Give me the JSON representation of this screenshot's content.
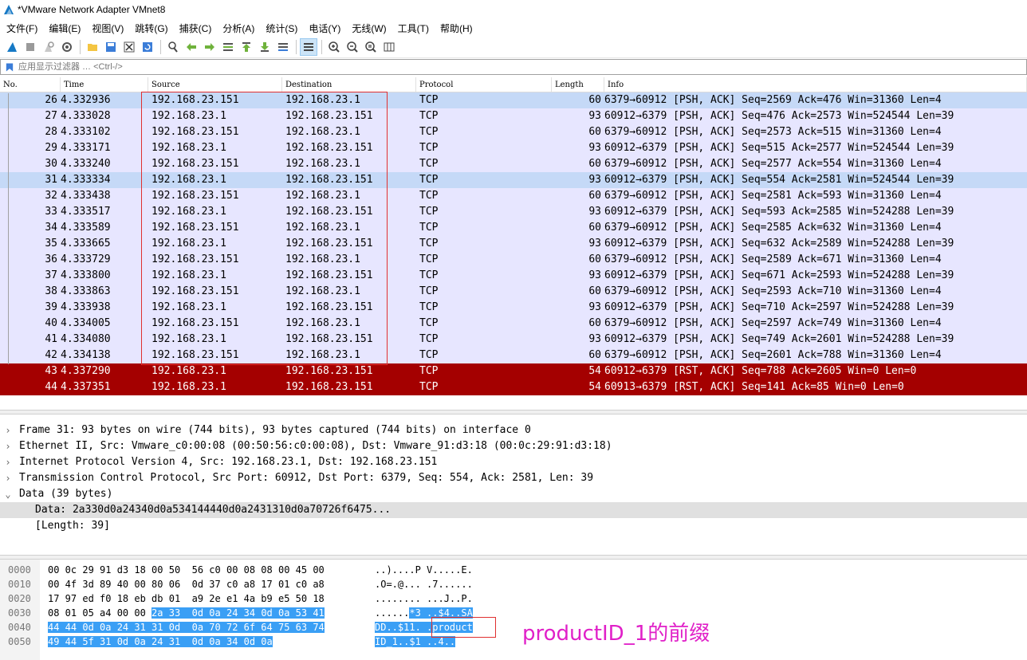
{
  "window": {
    "title": "*VMware Network Adapter VMnet8"
  },
  "menu": [
    "文件(F)",
    "编辑(E)",
    "视图(V)",
    "跳转(G)",
    "捕获(C)",
    "分析(A)",
    "统计(S)",
    "电话(Y)",
    "无线(W)",
    "工具(T)",
    "帮助(H)"
  ],
  "filter": {
    "placeholder": "应用显示过滤器 … <Ctrl-/>"
  },
  "columns": {
    "no": "No.",
    "time": "Time",
    "source": "Source",
    "destination": "Destination",
    "protocol": "Protocol",
    "length": "Length",
    "info": "Info"
  },
  "packets": [
    {
      "no": "26",
      "time": "4.332936",
      "src": "192.168.23.151",
      "dst": "192.168.23.1",
      "proto": "TCP",
      "len": "60",
      "info": "6379→60912 [PSH, ACK] Seq=2569 Ack=476 Win=31360 Len=4"
    },
    {
      "no": "27",
      "time": "4.333028",
      "src": "192.168.23.1",
      "dst": "192.168.23.151",
      "proto": "TCP",
      "len": "93",
      "info": "60912→6379 [PSH, ACK] Seq=476 Ack=2573 Win=524544 Len=39"
    },
    {
      "no": "28",
      "time": "4.333102",
      "src": "192.168.23.151",
      "dst": "192.168.23.1",
      "proto": "TCP",
      "len": "60",
      "info": "6379→60912 [PSH, ACK] Seq=2573 Ack=515 Win=31360 Len=4"
    },
    {
      "no": "29",
      "time": "4.333171",
      "src": "192.168.23.1",
      "dst": "192.168.23.151",
      "proto": "TCP",
      "len": "93",
      "info": "60912→6379 [PSH, ACK] Seq=515 Ack=2577 Win=524544 Len=39"
    },
    {
      "no": "30",
      "time": "4.333240",
      "src": "192.168.23.151",
      "dst": "192.168.23.1",
      "proto": "TCP",
      "len": "60",
      "info": "6379→60912 [PSH, ACK] Seq=2577 Ack=554 Win=31360 Len=4"
    },
    {
      "no": "31",
      "time": "4.333334",
      "src": "192.168.23.1",
      "dst": "192.168.23.151",
      "proto": "TCP",
      "len": "93",
      "info": "60912→6379 [PSH, ACK] Seq=554 Ack=2581 Win=524544 Len=39"
    },
    {
      "no": "32",
      "time": "4.333438",
      "src": "192.168.23.151",
      "dst": "192.168.23.1",
      "proto": "TCP",
      "len": "60",
      "info": "6379→60912 [PSH, ACK] Seq=2581 Ack=593 Win=31360 Len=4"
    },
    {
      "no": "33",
      "time": "4.333517",
      "src": "192.168.23.1",
      "dst": "192.168.23.151",
      "proto": "TCP",
      "len": "93",
      "info": "60912→6379 [PSH, ACK] Seq=593 Ack=2585 Win=524288 Len=39"
    },
    {
      "no": "34",
      "time": "4.333589",
      "src": "192.168.23.151",
      "dst": "192.168.23.1",
      "proto": "TCP",
      "len": "60",
      "info": "6379→60912 [PSH, ACK] Seq=2585 Ack=632 Win=31360 Len=4"
    },
    {
      "no": "35",
      "time": "4.333665",
      "src": "192.168.23.1",
      "dst": "192.168.23.151",
      "proto": "TCP",
      "len": "93",
      "info": "60912→6379 [PSH, ACK] Seq=632 Ack=2589 Win=524288 Len=39"
    },
    {
      "no": "36",
      "time": "4.333729",
      "src": "192.168.23.151",
      "dst": "192.168.23.1",
      "proto": "TCP",
      "len": "60",
      "info": "6379→60912 [PSH, ACK] Seq=2589 Ack=671 Win=31360 Len=4"
    },
    {
      "no": "37",
      "time": "4.333800",
      "src": "192.168.23.1",
      "dst": "192.168.23.151",
      "proto": "TCP",
      "len": "93",
      "info": "60912→6379 [PSH, ACK] Seq=671 Ack=2593 Win=524288 Len=39"
    },
    {
      "no": "38",
      "time": "4.333863",
      "src": "192.168.23.151",
      "dst": "192.168.23.1",
      "proto": "TCP",
      "len": "60",
      "info": "6379→60912 [PSH, ACK] Seq=2593 Ack=710 Win=31360 Len=4"
    },
    {
      "no": "39",
      "time": "4.333938",
      "src": "192.168.23.1",
      "dst": "192.168.23.151",
      "proto": "TCP",
      "len": "93",
      "info": "60912→6379 [PSH, ACK] Seq=710 Ack=2597 Win=524288 Len=39"
    },
    {
      "no": "40",
      "time": "4.334005",
      "src": "192.168.23.151",
      "dst": "192.168.23.1",
      "proto": "TCP",
      "len": "60",
      "info": "6379→60912 [PSH, ACK] Seq=2597 Ack=749 Win=31360 Len=4"
    },
    {
      "no": "41",
      "time": "4.334080",
      "src": "192.168.23.1",
      "dst": "192.168.23.151",
      "proto": "TCP",
      "len": "93",
      "info": "60912→6379 [PSH, ACK] Seq=749 Ack=2601 Win=524288 Len=39"
    },
    {
      "no": "42",
      "time": "4.334138",
      "src": "192.168.23.151",
      "dst": "192.168.23.1",
      "proto": "TCP",
      "len": "60",
      "info": "6379→60912 [PSH, ACK] Seq=2601 Ack=788 Win=31360 Len=4"
    },
    {
      "no": "43",
      "time": "4.337290",
      "src": "192.168.23.1",
      "dst": "192.168.23.151",
      "proto": "TCP",
      "len": "54",
      "info": "60912→6379 [RST, ACK] Seq=788 Ack=2605 Win=0 Len=0"
    },
    {
      "no": "44",
      "time": "4.337351",
      "src": "192.168.23.1",
      "dst": "192.168.23.151",
      "proto": "TCP",
      "len": "54",
      "info": "60913→6379 [RST, ACK] Seq=141 Ack=85 Win=0 Len=0"
    }
  ],
  "details": {
    "frame": "Frame 31: 93 bytes on wire (744 bits), 93 bytes captured (744 bits) on interface 0",
    "ethernet": "Ethernet II, Src: Vmware_c0:00:08 (00:50:56:c0:00:08), Dst: Vmware_91:d3:18 (00:0c:29:91:d3:18)",
    "ip": "Internet Protocol Version 4, Src: 192.168.23.1, Dst: 192.168.23.151",
    "tcp": "Transmission Control Protocol, Src Port: 60912, Dst Port: 6379, Seq: 554, Ack: 2581, Len: 39",
    "data": "Data (39 bytes)",
    "data_value": "Data: 2a330d0a24340d0a534144440d0a2431310d0a70726f6475...",
    "data_length": "[Length: 39]"
  },
  "bytes": [
    {
      "off": "0000",
      "hex": "00 0c 29 91 d3 18 00 50  56 c0 00 08 08 00 45 00",
      "hex_sel": "",
      "asc": "..)....P V.....E.",
      "asc_sel": ""
    },
    {
      "off": "0010",
      "hex": "00 4f 3d 89 40 00 80 06  0d 37 c0 a8 17 01 c0 a8",
      "hex_sel": "",
      "asc": ".O=.@... .7......",
      "asc_sel": ""
    },
    {
      "off": "0020",
      "hex": "17 97 ed f0 18 eb db 01  a9 2e e1 4a b9 e5 50 18",
      "hex_sel": "",
      "asc": "........ ...J..P.",
      "asc_sel": ""
    },
    {
      "off": "0030",
      "hex": "08 01 05 a4 00 00 ",
      "hex_sel": "2a 33  0d 0a 24 34 0d 0a 53 41",
      "asc": "......",
      "asc_sel": "*3 ..$4..SA"
    },
    {
      "off": "0040",
      "hex": "",
      "hex_sel": "44 44 0d 0a 24 31 31 0d  0a 70 72 6f 64 75 63 74",
      "asc": "",
      "asc_sel": "DD..$11. .product"
    },
    {
      "off": "0050",
      "hex": "",
      "hex_sel": "49 44 5f 31 0d 0a 24 31  0d 0a 34 0d 0a",
      "asc": "",
      "asc_sel": "ID_1..$1 ..4.."
    }
  ],
  "annotation": "productID_1的前缀",
  "colors": {
    "rst_row": "#a40000",
    "tcp_row": "#e7e6ff",
    "selected_row": "#c5d9f7",
    "byte_selection": "#3a9ff5",
    "annotation": "#e020c8",
    "highlight_box": "#e03030"
  }
}
